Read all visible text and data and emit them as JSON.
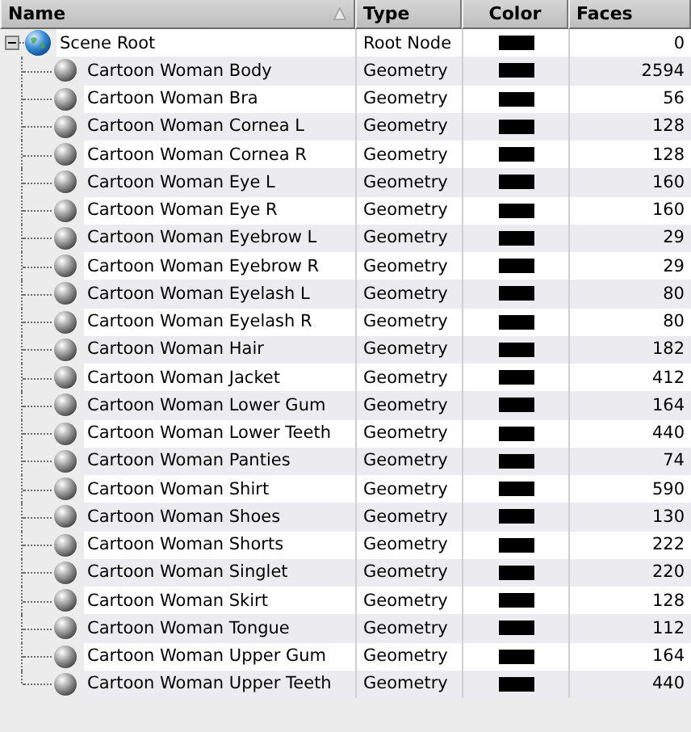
{
  "columns": [
    "Name",
    "Type",
    "Color",
    "Faces"
  ],
  "tree": {
    "name": "Scene Root",
    "type": "Root Node",
    "color": "#000000",
    "faces": "0",
    "expanded": true,
    "children": [
      {
        "name": "Cartoon Woman Body",
        "type": "Geometry",
        "color": "#000000",
        "faces": "2594"
      },
      {
        "name": "Cartoon Woman Bra",
        "type": "Geometry",
        "color": "#000000",
        "faces": "56"
      },
      {
        "name": "Cartoon Woman Cornea L",
        "type": "Geometry",
        "color": "#000000",
        "faces": "128"
      },
      {
        "name": "Cartoon Woman Cornea R",
        "type": "Geometry",
        "color": "#000000",
        "faces": "128"
      },
      {
        "name": "Cartoon Woman Eye L",
        "type": "Geometry",
        "color": "#000000",
        "faces": "160"
      },
      {
        "name": "Cartoon Woman Eye R",
        "type": "Geometry",
        "color": "#000000",
        "faces": "160"
      },
      {
        "name": "Cartoon Woman Eyebrow L",
        "type": "Geometry",
        "color": "#000000",
        "faces": "29"
      },
      {
        "name": "Cartoon Woman Eyebrow R",
        "type": "Geometry",
        "color": "#000000",
        "faces": "29"
      },
      {
        "name": "Cartoon Woman Eyelash L",
        "type": "Geometry",
        "color": "#000000",
        "faces": "80"
      },
      {
        "name": "Cartoon Woman Eyelash R",
        "type": "Geometry",
        "color": "#000000",
        "faces": "80"
      },
      {
        "name": "Cartoon Woman Hair",
        "type": "Geometry",
        "color": "#000000",
        "faces": "182"
      },
      {
        "name": "Cartoon Woman Jacket",
        "type": "Geometry",
        "color": "#000000",
        "faces": "412"
      },
      {
        "name": "Cartoon Woman Lower Gum",
        "type": "Geometry",
        "color": "#000000",
        "faces": "164"
      },
      {
        "name": "Cartoon Woman Lower Teeth",
        "type": "Geometry",
        "color": "#000000",
        "faces": "440"
      },
      {
        "name": "Cartoon Woman Panties",
        "type": "Geometry",
        "color": "#000000",
        "faces": "74"
      },
      {
        "name": "Cartoon Woman Shirt",
        "type": "Geometry",
        "color": "#000000",
        "faces": "590"
      },
      {
        "name": "Cartoon Woman Shoes",
        "type": "Geometry",
        "color": "#000000",
        "faces": "130"
      },
      {
        "name": "Cartoon Woman Shorts",
        "type": "Geometry",
        "color": "#000000",
        "faces": "222"
      },
      {
        "name": "Cartoon Woman Singlet",
        "type": "Geometry",
        "color": "#000000",
        "faces": "220"
      },
      {
        "name": "Cartoon Woman Skirt",
        "type": "Geometry",
        "color": "#000000",
        "faces": "128"
      },
      {
        "name": "Cartoon Woman Tongue",
        "type": "Geometry",
        "color": "#000000",
        "faces": "112"
      },
      {
        "name": "Cartoon Woman Upper Gum",
        "type": "Geometry",
        "color": "#000000",
        "faces": "164"
      },
      {
        "name": "Cartoon Woman Upper Teeth",
        "type": "Geometry",
        "color": "#000000",
        "faces": "440"
      }
    ]
  }
}
